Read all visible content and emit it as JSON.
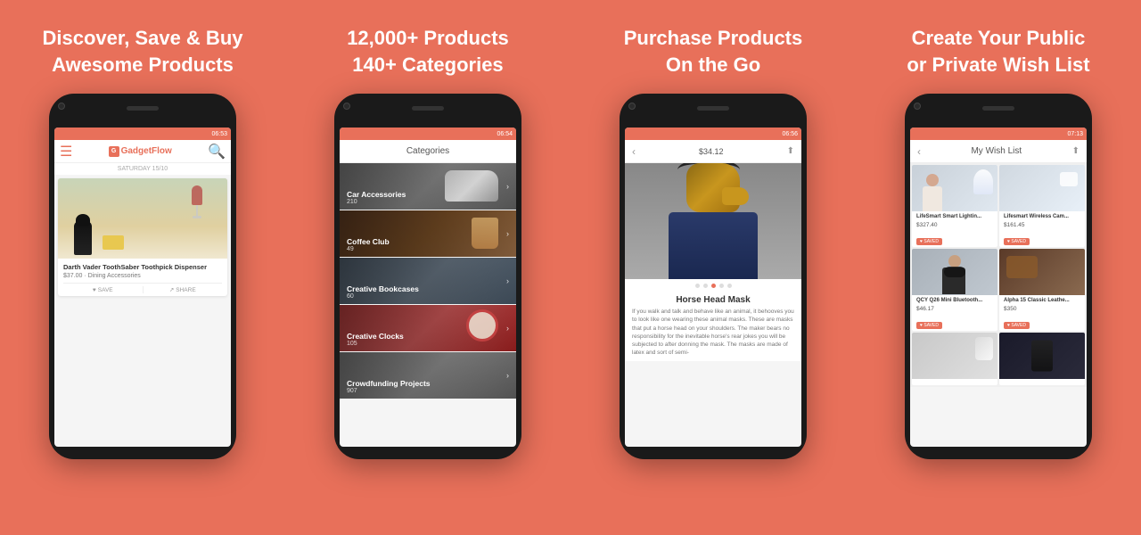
{
  "columns": [
    {
      "id": "col1",
      "heading_line1": "Discover, Save & Buy",
      "heading_line2": "Awesome Products",
      "phone": {
        "status_time": "06:53",
        "header": {
          "logo_text": "GadgetFlow",
          "logo_letter": "G"
        },
        "date_label": "SATURDAY 15/10",
        "card": {
          "title": "Darth Vader ToothSaber Toothpick Dispenser",
          "price": "$37.00 · Dining Accessories",
          "save_btn": "SAVE",
          "share_btn": "SHARE"
        }
      }
    },
    {
      "id": "col2",
      "heading_line1": "12,000+ Products",
      "heading_line2": "140+ Categories",
      "phone": {
        "status_time": "06:54",
        "header_title": "Categories",
        "categories": [
          {
            "name": "Car Accessories",
            "count": "210",
            "has_arrow": true
          },
          {
            "name": "Coffee Club",
            "count": "49",
            "has_arrow": true
          },
          {
            "name": "Creative Bookcases",
            "count": "60",
            "has_arrow": true
          },
          {
            "name": "Creative Clocks",
            "count": "105",
            "has_arrow": true
          },
          {
            "name": "Crowdfunding Projects",
            "count": "907",
            "has_arrow": true
          }
        ]
      }
    },
    {
      "id": "col3",
      "heading_line1": "Purchase Products",
      "heading_line2": "On the Go",
      "phone": {
        "status_time": "06:56",
        "price": "$34.12",
        "product_name": "Horse Head Mask",
        "description": "If you walk and talk and behave like an animal, it behooves you to look like one wearing these animal masks. These are masks that put a horse head on your shoulders. The maker bears no responsibility for the inevitable horse's rear jokes you will be subjected to after donning the mask. The masks are made of latex and sort of semi-"
      }
    },
    {
      "id": "col4",
      "heading_line1": "Create Your Public",
      "heading_line2": "or Private Wish List",
      "phone": {
        "status_time": "07:13",
        "header_title": "My Wish List",
        "wish_items": [
          {
            "name": "LifeSmart Smart Lightin...",
            "price": "$327.40",
            "saved": true,
            "img_class": "wish-img-bg1"
          },
          {
            "name": "Lifesmart Wireless Cam...",
            "price": "$161.45",
            "saved": true,
            "img_class": "wish-img-bg2"
          },
          {
            "name": "QCY Q26 Mini Bluetooth...",
            "price": "$46.17",
            "saved": true,
            "img_class": "wish-img-bg3"
          },
          {
            "name": "Alpha 15 Classic Leathe...",
            "price": "$350",
            "saved": true,
            "img_class": "wish-img-bg4"
          },
          {
            "name": "",
            "price": "",
            "saved": false,
            "img_class": "wish-img-bg5"
          },
          {
            "name": "",
            "price": "",
            "saved": false,
            "img_class": "wish-img-bg6"
          }
        ]
      }
    }
  ]
}
